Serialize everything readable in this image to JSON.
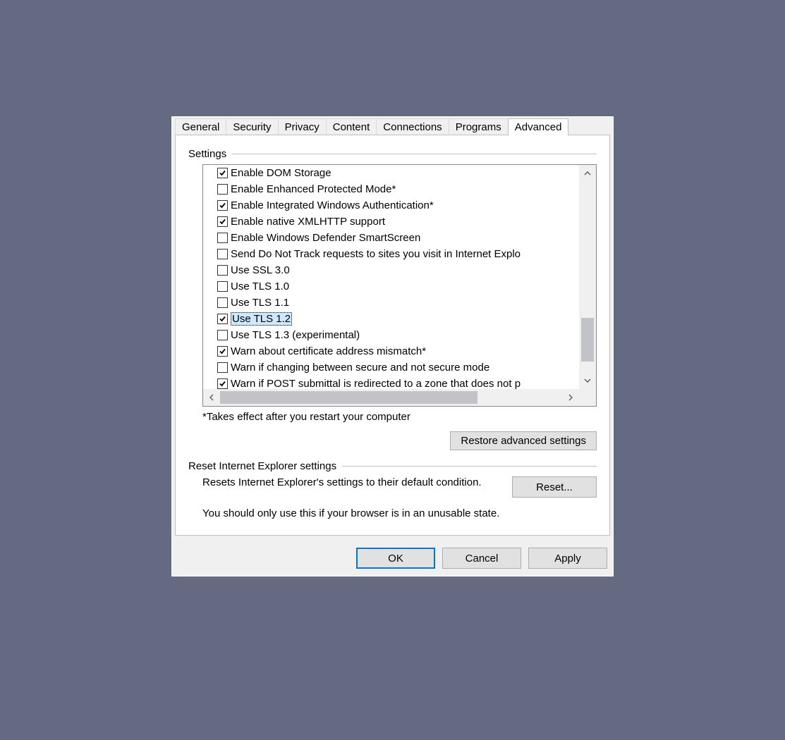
{
  "tabs": [
    "General",
    "Security",
    "Privacy",
    "Content",
    "Connections",
    "Programs",
    "Advanced"
  ],
  "active_tab": "Advanced",
  "group_label": "Settings",
  "items": [
    {
      "checked": true,
      "label": "Enable DOM Storage",
      "selected": false
    },
    {
      "checked": false,
      "label": "Enable Enhanced Protected Mode*",
      "selected": false
    },
    {
      "checked": true,
      "label": "Enable Integrated Windows Authentication*",
      "selected": false
    },
    {
      "checked": true,
      "label": "Enable native XMLHTTP support",
      "selected": false
    },
    {
      "checked": false,
      "label": "Enable Windows Defender SmartScreen",
      "selected": false
    },
    {
      "checked": false,
      "label": "Send Do Not Track requests to sites you visit in Internet Explo",
      "selected": false
    },
    {
      "checked": false,
      "label": "Use SSL 3.0",
      "selected": false
    },
    {
      "checked": false,
      "label": "Use TLS 1.0",
      "selected": false
    },
    {
      "checked": false,
      "label": "Use TLS 1.1",
      "selected": false
    },
    {
      "checked": true,
      "label": "Use TLS 1.2",
      "selected": true
    },
    {
      "checked": false,
      "label": "Use TLS 1.3 (experimental)",
      "selected": false
    },
    {
      "checked": true,
      "label": "Warn about certificate address mismatch*",
      "selected": false
    },
    {
      "checked": false,
      "label": "Warn if changing between secure and not secure mode",
      "selected": false
    },
    {
      "checked": true,
      "label": "Warn if POST submittal is redirected to a zone that does not p",
      "selected": false
    }
  ],
  "footnote": "*Takes effect after you restart your computer",
  "restore_label": "Restore advanced settings",
  "reset_group_label": "Reset Internet Explorer settings",
  "reset_desc": "Resets Internet Explorer's settings to their default condition.",
  "reset_button": "Reset...",
  "reset_warn": "You should only use this if your browser is in an unusable state.",
  "buttons": {
    "ok": "OK",
    "cancel": "Cancel",
    "apply": "Apply"
  }
}
